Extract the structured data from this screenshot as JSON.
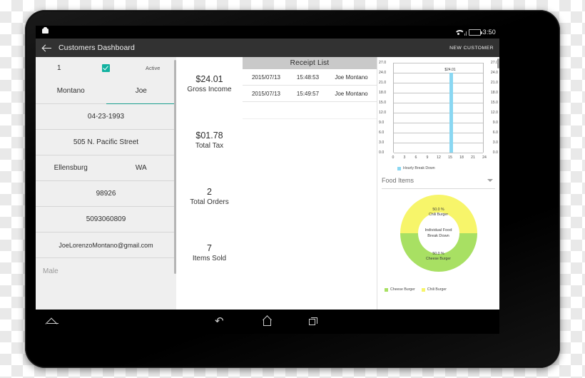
{
  "device": {
    "status_bar": {
      "clock": "3:50",
      "wifi_icon": "wifi-icon",
      "battery_icon": "battery-icon",
      "notification_icon": "notification-icon"
    },
    "nav_bar": {
      "expand_icon": "expand-up-icon",
      "back_icon": "back-icon",
      "home_icon": "home-icon",
      "recents_icon": "recent-apps-icon"
    }
  },
  "appbar": {
    "back_icon": "back-arrow-icon",
    "title": "Customers Dashboard",
    "action_label": "NEW CUSTOMER"
  },
  "customer_form": {
    "id": "1",
    "active_checked": true,
    "active_label": "Active",
    "last_name": "Montano",
    "first_name": "Joe",
    "birthdate": "04-23-1993",
    "street": "505 N. Pacific Street",
    "city": "Ellensburg",
    "state": "WA",
    "zip": "98926",
    "phone": "5093060809",
    "email": "JoeLorenzoMontano@gmail.com",
    "gender_placeholder": "Male"
  },
  "stats": [
    {
      "value": "$24.01",
      "label": "Gross Income"
    },
    {
      "value": "$01.78",
      "label": "Total Tax"
    },
    {
      "value": "2",
      "label": "Total Orders"
    },
    {
      "value": "7",
      "label": "Items Sold"
    }
  ],
  "receipts": {
    "header": "Receipt List",
    "rows": [
      {
        "date": "2015/07/13",
        "time": "15:48:53",
        "name": "Joe Montano"
      },
      {
        "date": "2015/07/13",
        "time": "15:49:57",
        "name": "Joe Montano"
      }
    ]
  },
  "food_select": {
    "value": "Food Items",
    "caret_icon": "chevron-down-icon"
  },
  "chart_data": [
    {
      "type": "bar",
      "title": "",
      "xlabel": "",
      "ylabel": "",
      "categories": [
        0,
        3,
        6,
        9,
        12,
        15,
        18,
        21,
        24
      ],
      "xticks": [
        "0",
        "3",
        "6",
        "9",
        "12",
        "15",
        "18",
        "21",
        "24"
      ],
      "yticks": [
        "0.0",
        "3.0",
        "6.0",
        "9.0",
        "12.0",
        "15.0",
        "18.0",
        "21.0",
        "24.0",
        "27.0"
      ],
      "xlim": [
        0,
        24
      ],
      "ylim": [
        0,
        27
      ],
      "grid": true,
      "legend_position": "bottom-left",
      "legend": [
        "Hourly Break Down"
      ],
      "series": [
        {
          "name": "Hourly Break Down",
          "color": "#8ad7f2",
          "points": [
            {
              "x": 15,
              "y": 24.01,
              "label": "$24.01"
            }
          ]
        }
      ]
    },
    {
      "type": "pie",
      "variant": "donut",
      "title": "",
      "center_text_line1": "Individual Food",
      "center_text_line2": "Break Down",
      "legend_position": "bottom-left",
      "slices": [
        {
          "name": "Chili Burger",
          "percent": 50.0,
          "percent_label": "50.0 %",
          "color": "#f7f56a"
        },
        {
          "name": "Cheese Burger",
          "percent": 50.0,
          "percent_label": "50.0 %",
          "color": "#a8e063"
        }
      ],
      "legend": [
        "Cheese Burger",
        "Chili Burger"
      ]
    }
  ],
  "colors": {
    "accent_teal": "#12b2a0",
    "appbar": "#323232",
    "bar_blue": "#8ad7f2",
    "pie_yellow": "#f7f56a",
    "pie_green": "#a8e063",
    "battery_green": "#66cc33"
  }
}
